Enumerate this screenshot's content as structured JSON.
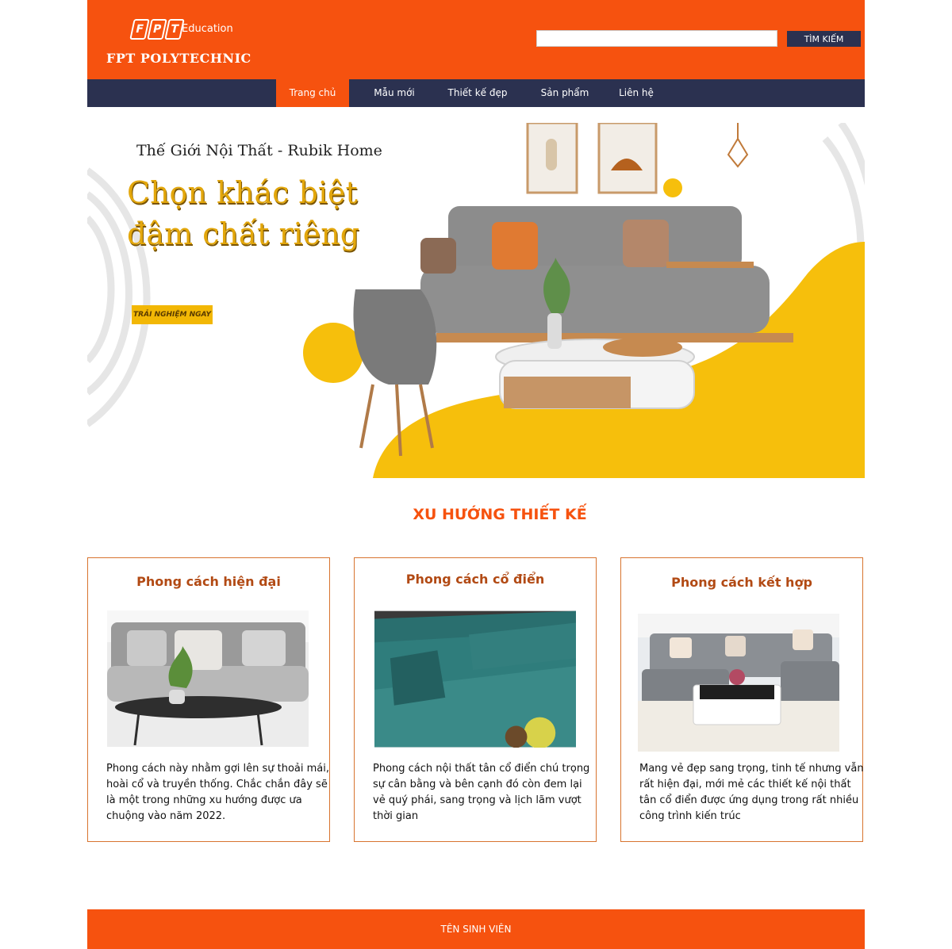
{
  "header": {
    "logo_mark": [
      "F",
      "P",
      "T"
    ],
    "logo_sub": "Education",
    "logo_name": "FPT POLYTECHNIC",
    "search_placeholder": "",
    "search_button": "TÌM KIẾM"
  },
  "nav": {
    "items": [
      {
        "label": "Trang chủ",
        "active": true
      },
      {
        "label": "Mẫu mới",
        "active": false
      },
      {
        "label": "Thiết kế đẹp",
        "active": false
      },
      {
        "label": "Sản phẩm",
        "active": false
      },
      {
        "label": "Liên hệ",
        "active": false
      }
    ]
  },
  "banner": {
    "subtitle": "Thế Giới Nội Thất - Rubik Home",
    "title_line1": "Chọn khác biệt",
    "title_line2": "đậm chất riêng",
    "cta": "TRẢI NGHIỆM NGAY",
    "accent_color": "#f6bf0c"
  },
  "section": {
    "title": "XU HƯỚNG THIẾT KẾ"
  },
  "cards": [
    {
      "title": "Phong cách hiện đại",
      "text": "Phong cách này nhằm gợi lên sự thoải mái, hoài cổ và truyền thống. Chắc chắn đây sẽ là một trong những xu hướng được ưa chuộng vào năm 2022."
    },
    {
      "title": "Phong cách cổ điển",
      "text": "Phong cách nội thất tân cổ điển chú trọng sự cân bằng và bên cạnh đó còn đem lại vẻ quý phái, sang trọng và lịch lãm vượt thời gian"
    },
    {
      "title": "Phong cách kết hợp",
      "text": "Mang vẻ đẹp sang trọng, tinh tế nhưng vẫn rất hiện đại, mới mẻ các thiết kế nội thất tân cổ điển được ứng dụng trong rất nhiều công trình kiến trúc"
    }
  ],
  "footer": {
    "text": "TÊN SINH VIÊN"
  },
  "colors": {
    "brand_orange": "#f6520f",
    "nav_navy": "#2b3150",
    "card_title": "#b24a14"
  }
}
